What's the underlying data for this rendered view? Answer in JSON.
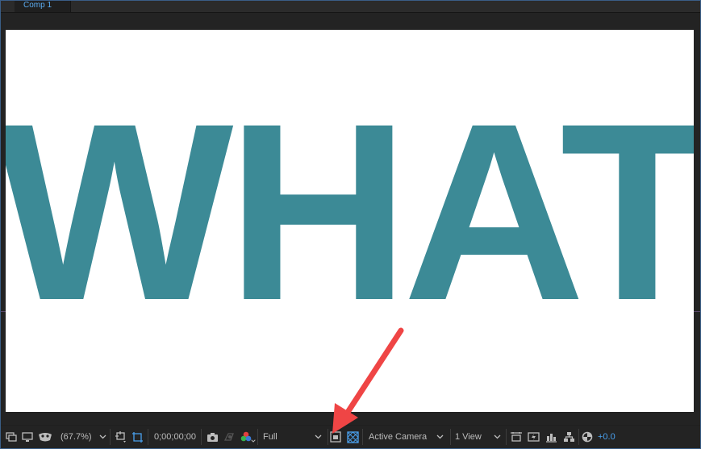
{
  "comp_tab": {
    "label": "Comp 1"
  },
  "canvas": {
    "text": "WHAT",
    "text_color": "#3c8a96",
    "background": "#ffffff"
  },
  "toolbar": {
    "zoom": "(67.7%)",
    "timecode": "0;00;00;00",
    "resolution": "Full",
    "camera": "Active Camera",
    "view_layout": "1 View",
    "exposure": "+0.0"
  },
  "annotation": {
    "arrow_color": "#ef4545"
  },
  "icons": [
    "always-preview-icon",
    "monitor-icon",
    "mask-visibility-icon",
    "region-of-interest-icon",
    "transparency-grid-icon",
    "snapshot-camera-icon",
    "show-snapshot-icon",
    "color-channels-icon",
    "region-of-interest-toggle-icon",
    "transparency-grid-toggle-icon",
    "view-options-icon",
    "fast-previews-icon",
    "timeline-icon",
    "flowchart-icon",
    "reset-exposure-icon"
  ]
}
